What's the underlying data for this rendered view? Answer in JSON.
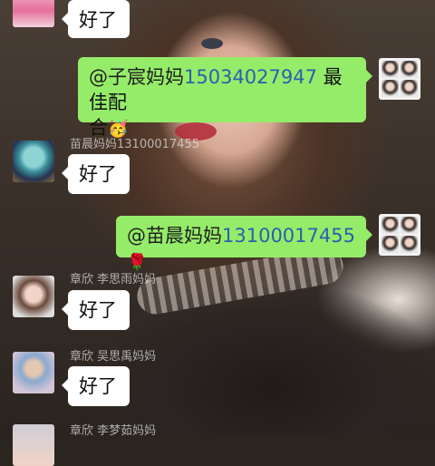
{
  "messages": [
    {
      "side": "left",
      "text": "好了"
    },
    {
      "side": "right",
      "mention": "@子宸妈妈",
      "phone": "15034027947",
      "text_line1_tail": " 最佳配",
      "text_line2": "合",
      "emoji": "🥳"
    },
    {
      "side": "left",
      "nick": "苗晨妈妈13100017455",
      "text": "好了"
    },
    {
      "side": "right",
      "mention": "@苗晨妈妈",
      "phone": "13100017455",
      "emoji": "🌹"
    },
    {
      "side": "left",
      "nick": "章欣 李思雨妈妈",
      "text": "好了"
    },
    {
      "side": "left",
      "nick": "章欣  吴思禹妈妈",
      "text": "好了"
    },
    {
      "side": "left",
      "nick": "章欣  李梦茹妈妈"
    }
  ]
}
